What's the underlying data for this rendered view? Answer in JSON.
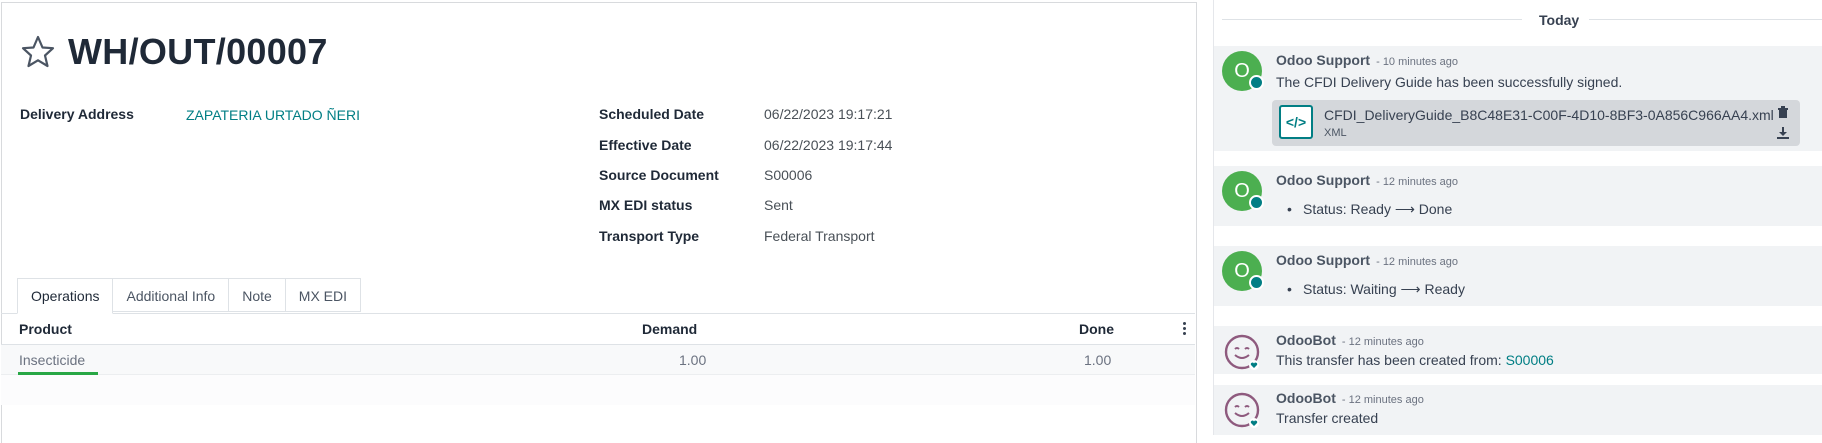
{
  "record": {
    "title": "WH/OUT/00007"
  },
  "fields": {
    "delivery_address_label": "Delivery Address",
    "delivery_address_value": "ZAPATERIA URTADO ÑERI",
    "scheduled_date_label": "Scheduled Date",
    "scheduled_date_value": "06/22/2023 19:17:21",
    "effective_date_label": "Effective Date",
    "effective_date_value": "06/22/2023 19:17:44",
    "source_document_label": "Source Document",
    "source_document_value": "S00006",
    "mx_edi_status_label": "MX EDI status",
    "mx_edi_status_value": "Sent",
    "transport_type_label": "Transport Type",
    "transport_type_value": "Federal Transport"
  },
  "tabs": [
    {
      "label": "Operations"
    },
    {
      "label": "Additional Info"
    },
    {
      "label": "Note"
    },
    {
      "label": "MX EDI"
    }
  ],
  "table": {
    "headers": {
      "product": "Product",
      "demand": "Demand",
      "done": "Done"
    },
    "rows": [
      {
        "product": "Insecticide",
        "demand": "1.00",
        "done": "1.00"
      }
    ]
  },
  "chatter": {
    "today": "Today",
    "messages": [
      {
        "avatar": "O",
        "author": "Odoo Support",
        "time": "- 10 minutes ago",
        "body": "The CFDI Delivery Guide has been successfully signed.",
        "attachment": {
          "name": "CFDI_DeliveryGuide_B8C48E31-C00F-4D10-8BF3-0A856C966AA4.xml",
          "type": "XML",
          "icon": "code-icon"
        }
      },
      {
        "avatar": "O",
        "author": "Odoo Support",
        "time": "- 12 minutes ago",
        "bullet": "Status: Ready ⟶ Done"
      },
      {
        "avatar": "O",
        "author": "Odoo Support",
        "time": "- 12 minutes ago",
        "bullet": "Status: Waiting ⟶ Ready"
      },
      {
        "author": "OdooBot",
        "time": "- 12 minutes ago",
        "body_prefix": "This transfer has been created from: ",
        "body_link": "S00006"
      },
      {
        "author": "OdooBot",
        "time": "- 12 minutes ago",
        "body": "Transfer created"
      }
    ]
  },
  "colors": {
    "accent": "#017e84",
    "avatar_green": "#4caf50",
    "underline_green": "#28a745",
    "bot_purple": "#8e5a7e"
  }
}
